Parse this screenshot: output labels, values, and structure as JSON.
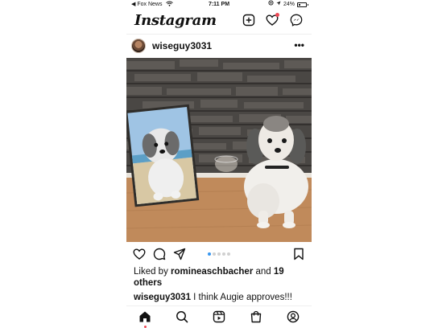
{
  "status_bar": {
    "carrier": "◀ Fox News",
    "time": "7:11 PM",
    "battery_text": "24%",
    "battery_level": 0.24
  },
  "header": {
    "logo": "Instagram",
    "icons": [
      "new-post-icon",
      "activity-heart-icon",
      "messenger-icon"
    ]
  },
  "post": {
    "username": "wiseguy3031",
    "more_label": "•••",
    "carousel": {
      "total": 5,
      "active_index": 0
    },
    "likes": {
      "prefix": "Liked by ",
      "user": "romineaschbacher",
      "middle": " and ",
      "others": "19 others"
    },
    "caption": {
      "user": "wiseguy3031",
      "text": " I think Augie approves!!!"
    }
  },
  "bottom_nav": {
    "items": [
      "home-icon",
      "search-icon",
      "reels-icon",
      "shop-icon",
      "profile-icon"
    ],
    "active": "home-icon"
  },
  "colors": {
    "accent_blue": "#3897f0",
    "notification_red": "#ed4956",
    "text": "#111111"
  }
}
